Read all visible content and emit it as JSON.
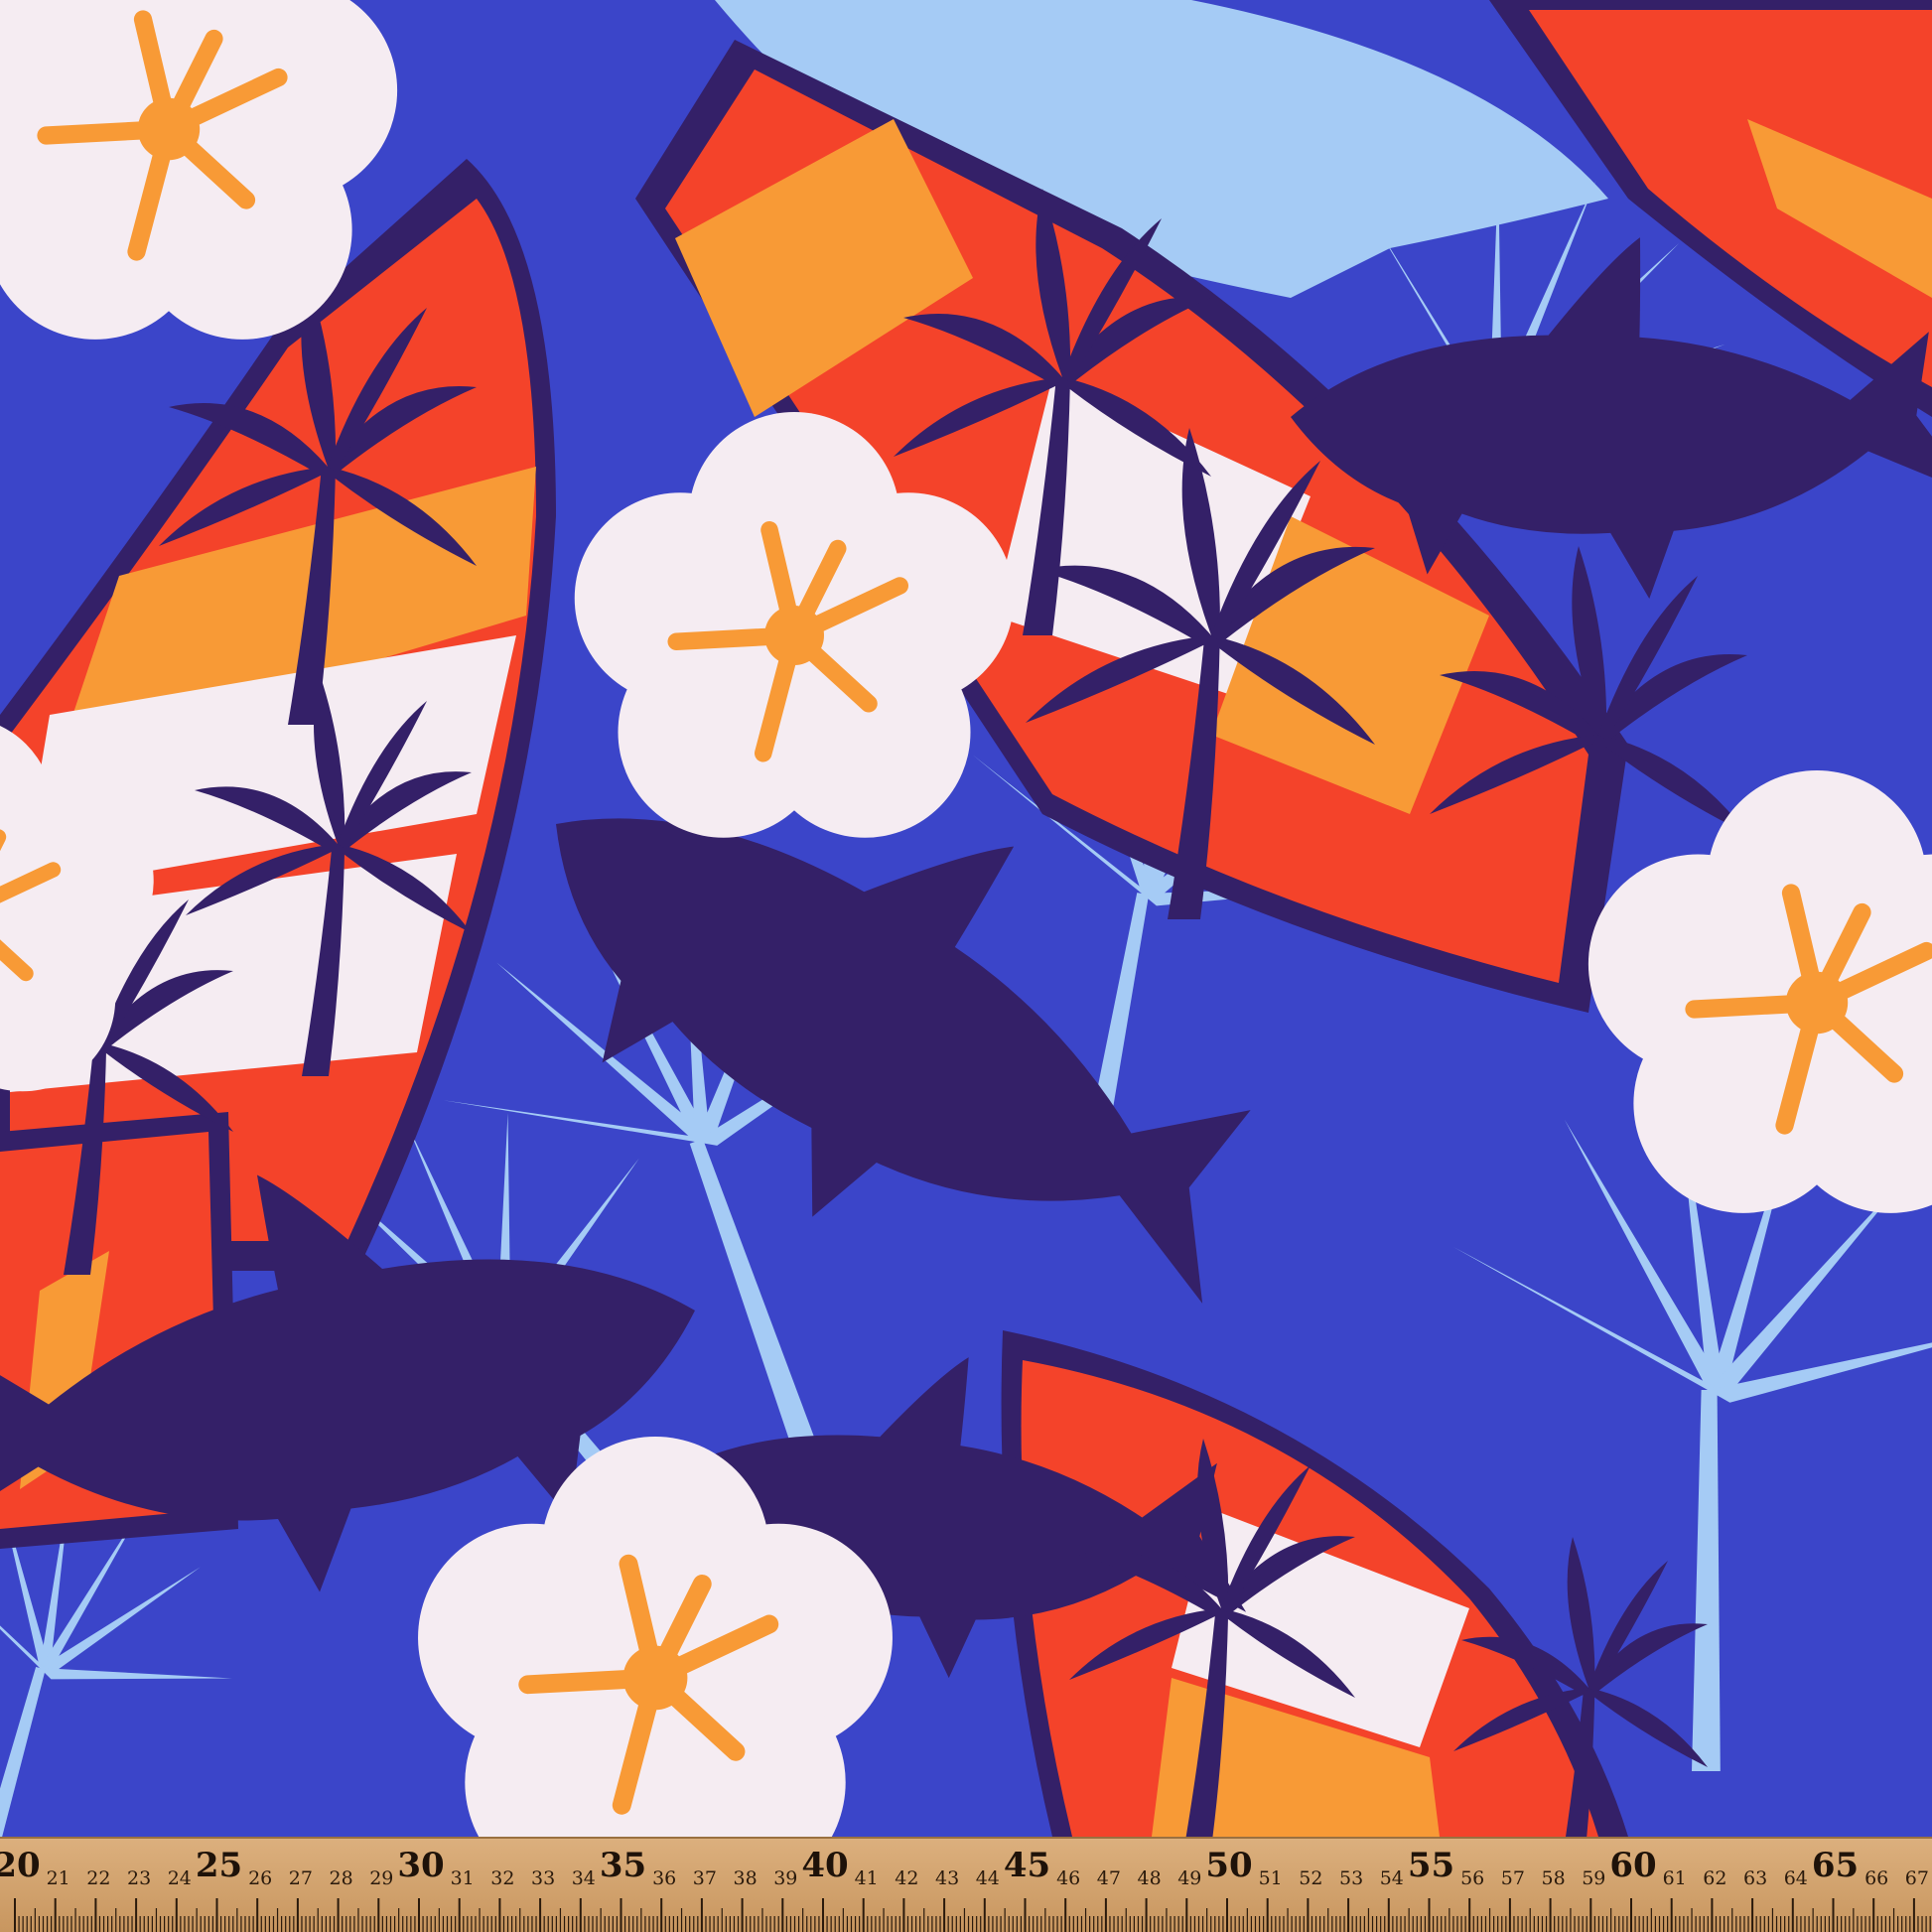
{
  "image": {
    "description_free": true,
    "palette": {
      "background_blue": "#3b45c9",
      "light_blue": "#a5cbf5",
      "navy": "#342068",
      "red": "#f4432a",
      "orange": "#f89a36",
      "white": "#f5ecf2",
      "ruler_wood": "#d2a472",
      "ruler_ink": "#1e1209"
    }
  },
  "ruler": {
    "unit": "cm",
    "first_cm": 20,
    "last_cm": 67,
    "labels": [
      "20",
      "21",
      "22",
      "23",
      "24",
      "25",
      "26",
      "27",
      "28",
      "29",
      "30",
      "31",
      "32",
      "33",
      "34",
      "35",
      "36",
      "37",
      "38",
      "39",
      "40",
      "41",
      "42",
      "43",
      "44",
      "45",
      "46",
      "47",
      "48",
      "49",
      "50",
      "51",
      "52",
      "53",
      "54",
      "55",
      "56",
      "57",
      "58",
      "59",
      "60",
      "61",
      "62",
      "63",
      "64",
      "65",
      "66",
      "67"
    ]
  }
}
